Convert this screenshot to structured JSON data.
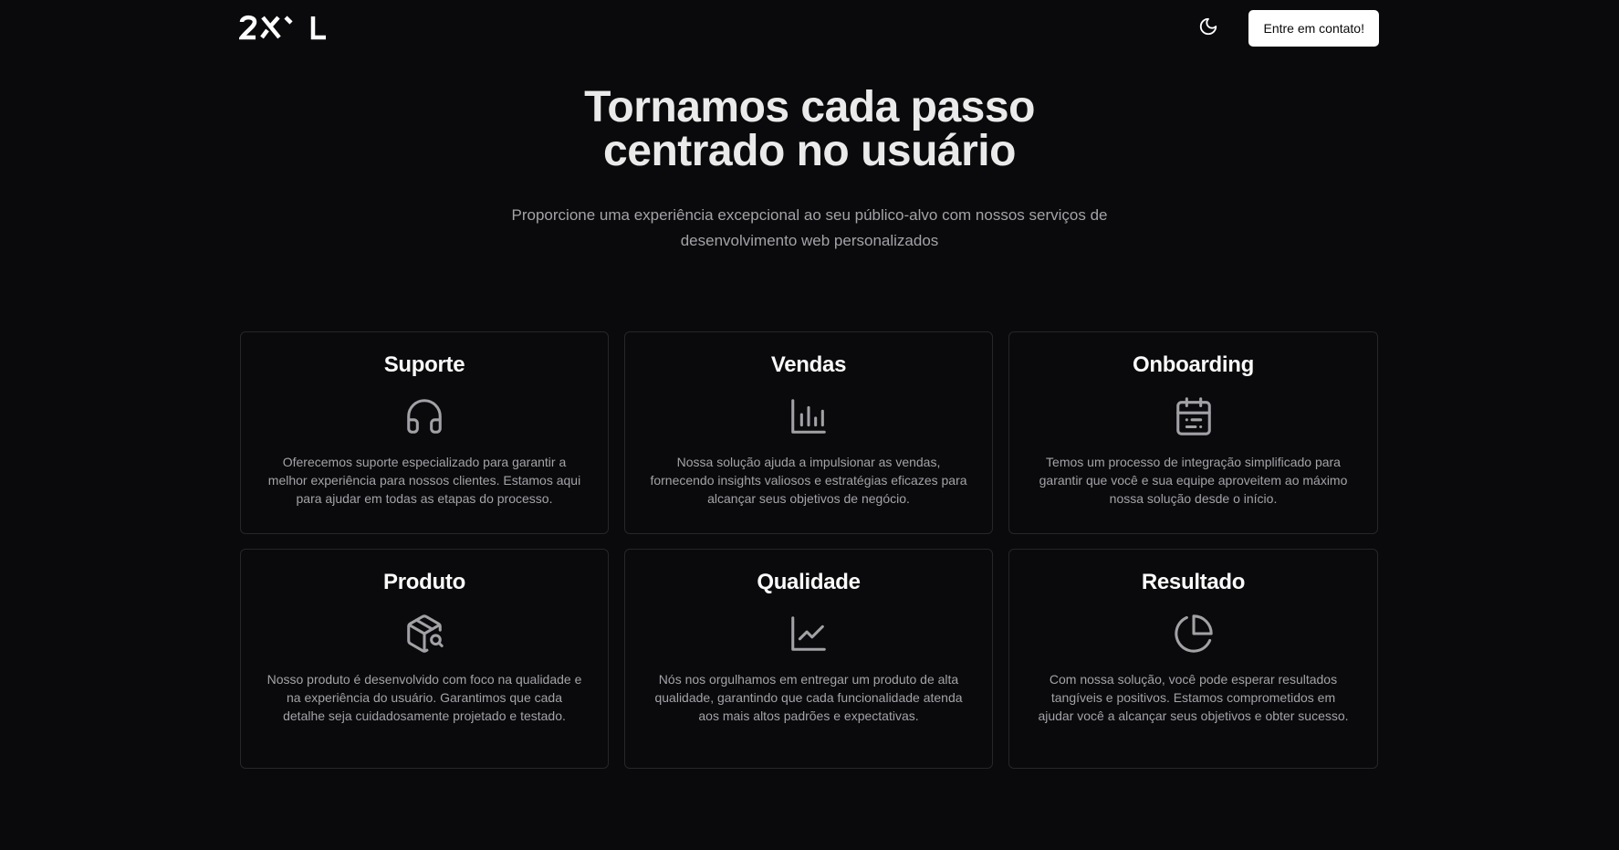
{
  "header": {
    "logo_text": "2XL",
    "theme_toggle_icon": "moon-icon",
    "contact_button": "Entre em contato!"
  },
  "hero": {
    "title": "Tornamos cada passo centrado no usuário",
    "subtitle": "Proporcione uma experiência excepcional ao seu público-alvo com nossos serviços de desenvolvimento web personalizados"
  },
  "features": [
    {
      "title": "Suporte",
      "icon": "headphones-icon",
      "description": "Oferecemos suporte especializado para garantir a melhor experiência para nossos clientes. Estamos aqui para ajudar em todas as etapas do processo."
    },
    {
      "title": "Vendas",
      "icon": "bar-chart-icon",
      "description": "Nossa solução ajuda a impulsionar as vendas, fornecendo insights valiosos e estratégias eficazes para alcançar seus objetivos de negócio."
    },
    {
      "title": "Onboarding",
      "icon": "calendar-icon",
      "description": "Temos um processo de integração simplificado para garantir que você e sua equipe aproveitem ao máximo nossa solução desde o início."
    },
    {
      "title": "Produto",
      "icon": "package-search-icon",
      "description": "Nosso produto é desenvolvido com foco na qualidade e na experiência do usuário. Garantimos que cada detalhe seja cuidadosamente projetado e testado."
    },
    {
      "title": "Qualidade",
      "icon": "line-chart-icon",
      "description": "Nós nos orgulhamos em entregar um produto de alta qualidade, garantindo que cada funcionalidade atenda aos mais altos padrões e expectativas."
    },
    {
      "title": "Resultado",
      "icon": "pie-chart-icon",
      "description": "Com nossa solução, você pode esperar resultados tangíveis e positivos. Estamos comprometidos em ajudar você a alcançar seus objetivos e obter sucesso."
    }
  ],
  "colors": {
    "background": "#0a0a0c",
    "card_border": "#26262b",
    "heading": "#fafafa",
    "muted_text": "#a3a3a8",
    "icon": "#a1a1a6",
    "button_bg": "#ffffff"
  }
}
